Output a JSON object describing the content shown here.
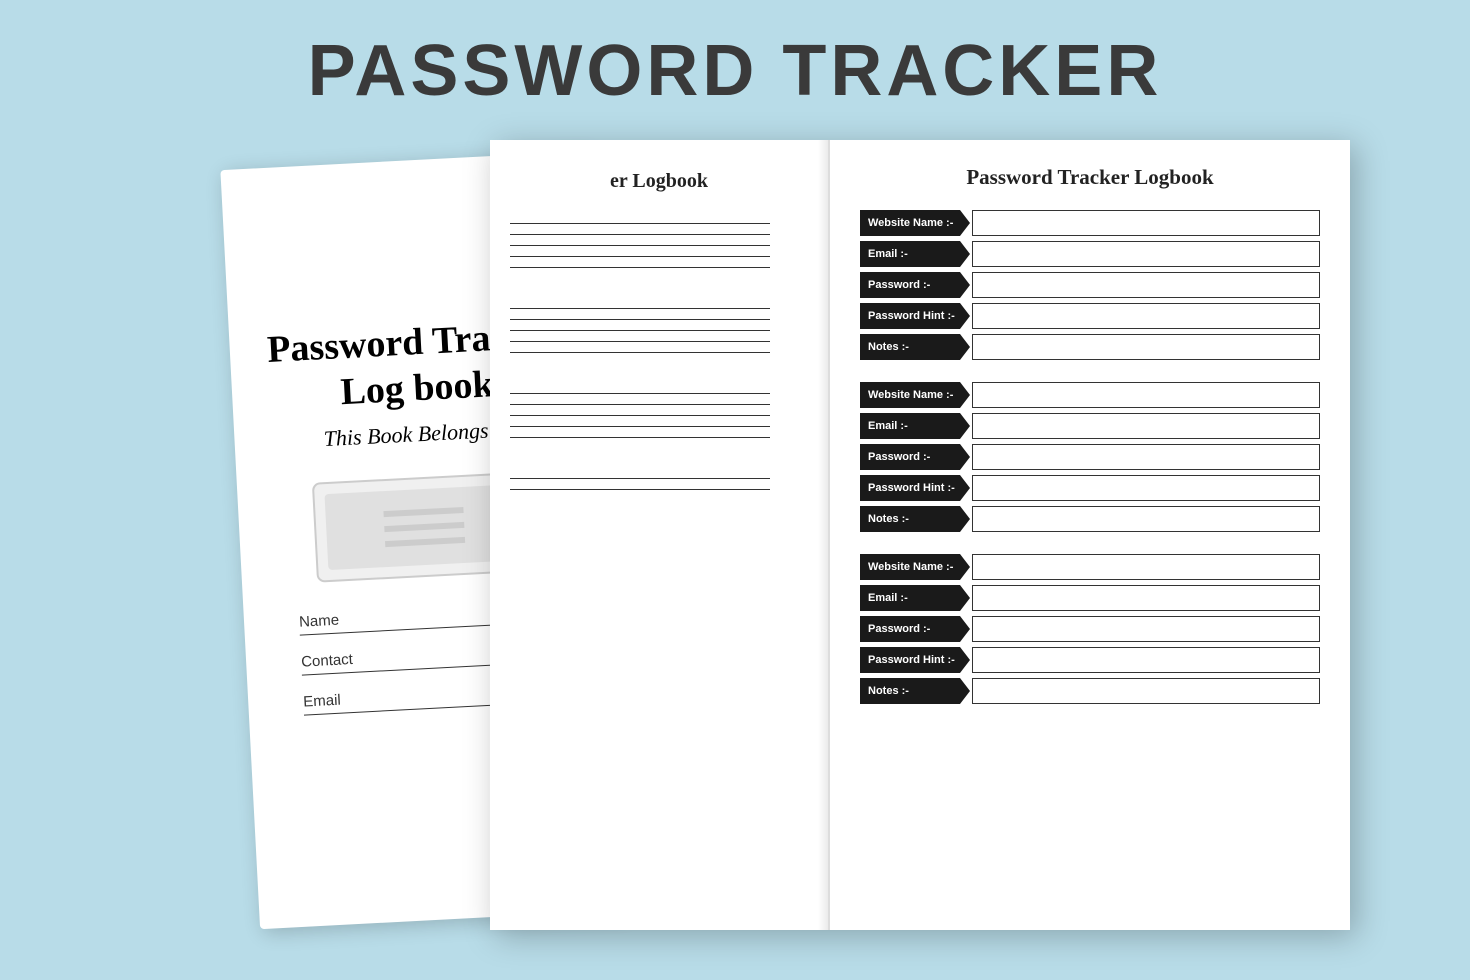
{
  "mainTitle": "PASSWORD TRACKER",
  "cover": {
    "title": "Password Tracker\nLog book",
    "subtitle": "This Book Belongs To",
    "fields": [
      {
        "label": "Name"
      },
      {
        "label": "Contact"
      },
      {
        "label": "Email"
      }
    ]
  },
  "leftPage": {
    "title": "er Logbook",
    "lineGroups": [
      5,
      5,
      5,
      2
    ]
  },
  "rightPage": {
    "title": "Password Tracker Logbook",
    "entries": [
      {
        "fields": [
          {
            "label": "Website Name :-"
          },
          {
            "label": "Email :-"
          },
          {
            "label": "Password :-"
          },
          {
            "label": "Password Hint :-"
          },
          {
            "label": "Notes :-"
          }
        ]
      },
      {
        "fields": [
          {
            "label": "Website Name :-"
          },
          {
            "label": "Email :-"
          },
          {
            "label": "Password :-"
          },
          {
            "label": "Password Hint :-"
          },
          {
            "label": "Notes :-"
          }
        ]
      },
      {
        "fields": [
          {
            "label": "Website Name :-"
          },
          {
            "label": "Email :-"
          },
          {
            "label": "Password :-"
          },
          {
            "label": "Password Hint :-"
          },
          {
            "label": "Notes :-"
          }
        ]
      }
    ]
  }
}
